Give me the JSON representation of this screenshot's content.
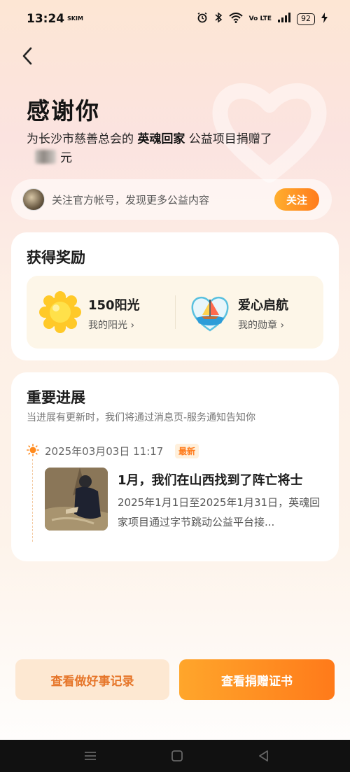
{
  "status_bar": {
    "time": "13:24",
    "carrier": "SKIM",
    "volte": "Vo LTE",
    "battery": "92"
  },
  "header": {
    "title": "感谢你",
    "line_prefix": "为长沙市慈善总会的 ",
    "project": "英魂回家",
    "line_suffix": " 公益项目捐赠了",
    "amount_unit": "元"
  },
  "follow": {
    "text": "关注官方帐号，发现更多公益内容",
    "button": "关注"
  },
  "rewards": {
    "title": "获得奖励",
    "items": [
      {
        "name": "150阳光",
        "sub": "我的阳光",
        "chevron": "›",
        "icon": "sun-icon"
      },
      {
        "name": "爱心启航",
        "sub": "我的勋章",
        "chevron": "›",
        "icon": "sailboat-badge-icon"
      }
    ]
  },
  "progress": {
    "title": "重要进展",
    "desc": "当进展有更新时，我们将通过消息页-服务通知告知你",
    "date": "2025年03月03日 11:17",
    "latest_badge": "最新",
    "news_title": "1月，我们在山西找到了阵亡将士",
    "news_body": "2025年1月1日至2025年1月31日，英魂回家项目通过字节跳动公益平台接..."
  },
  "buttons": {
    "record": "查看做好事记录",
    "certificate": "查看捐赠证书"
  },
  "colors": {
    "accent": "#ff7a1a",
    "accent_light": "#ffae2e",
    "record_bg": "#fde8d2"
  }
}
